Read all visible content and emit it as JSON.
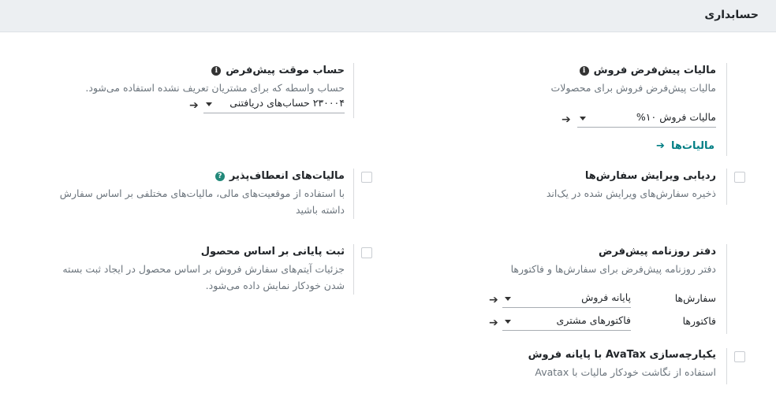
{
  "header": {
    "title": "حسابداری"
  },
  "default_taxes": {
    "title": "مالیات پیش‌فرض فروش",
    "desc": "مالیات پیش‌فرض فروش برای محصولات",
    "label": "مالیات فروش",
    "value": "۱۰%",
    "link": "مالیات‌ها"
  },
  "suspense_account": {
    "title": "حساب موقت پیش‌فرض",
    "desc": "حساب واسطه که برای مشتریان تعریف نشده استفاده می‌شود.",
    "value": "۲۳۰۰۰۴ حساب‌های دریافتنی"
  },
  "order_edit_tracking": {
    "title": "ردیابی ویرایش سفارش‌ها",
    "desc": "ذخیره سفارش‌های ویرایش شده در یک‌اند",
    "checked": false
  },
  "flexible_taxes": {
    "title": "مالیات‌های انعطاف‌پذیر",
    "desc_line1": "با استفاده از موقعیت‌های مالی، مالیات‌های مختلفی بر اساس سفارش",
    "desc_line2": "داشته باشید",
    "checked": false
  },
  "default_journals": {
    "title": "دفتر روزنامه پیش‌فرض",
    "desc": "دفتر روزنامه پیش‌فرض برای سفارش‌ها و فاکتورها",
    "orders_label": "سفارش‌ها",
    "orders_value": "پایانه فروش",
    "invoices_label": "فاکتورها",
    "invoices_value": "فاکتورهای مشتری"
  },
  "product_closing": {
    "title": "ثبت پایانی بر اساس محصول",
    "desc_line1": "جزئیات آیتم‌های سفارش فروش بر اساس محصول در ایجاد ثبت بسته",
    "desc_line2": "شدن خودکار نمایش داده می‌شود.",
    "checked": false
  },
  "avatax": {
    "title": "یکپارچه‌سازی AvaTax با پایانه فروش",
    "desc": "استفاده از نگاشت خودکار مالیات با Avatax",
    "checked": false
  },
  "icons": {
    "info": "info-icon",
    "help": "help-icon",
    "arrow": "arrow-right-icon",
    "caret": "caret-down-icon"
  },
  "colors": {
    "link": "#017e84",
    "help": "#22897a",
    "header_bg": "#eceff2"
  }
}
